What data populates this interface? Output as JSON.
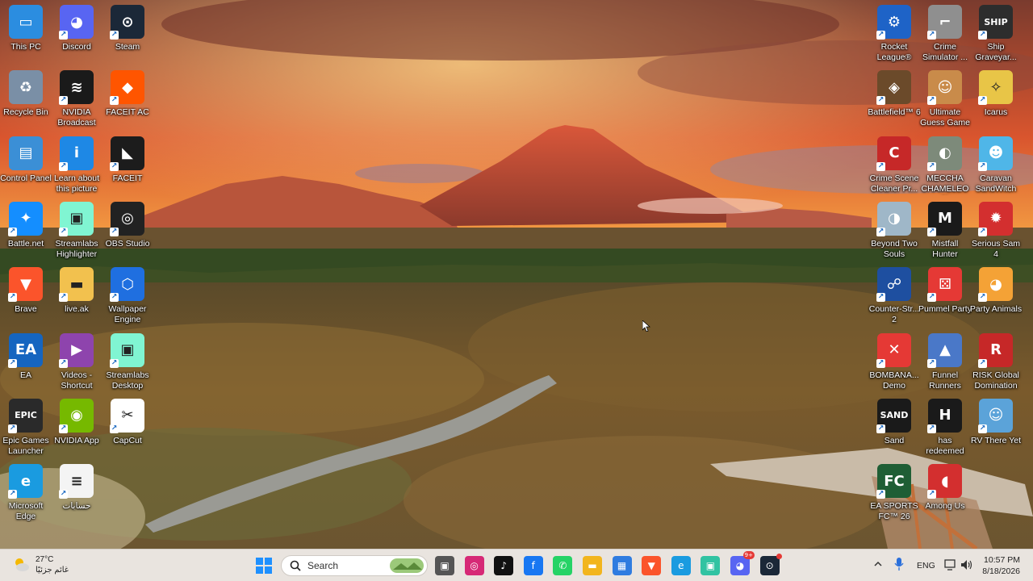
{
  "desktop": {
    "left_icons": [
      {
        "label": "This PC",
        "icon": "monitor-icon",
        "color": "#2b8de0",
        "glyph": "▭"
      },
      {
        "label": "Discord",
        "icon": "discord-icon",
        "color": "#5865f2",
        "glyph": "◕"
      },
      {
        "label": "Steam",
        "icon": "steam-icon",
        "color": "#1b2838",
        "glyph": "⊙"
      },
      {
        "label": "Recycle Bin",
        "icon": "recycle-bin-icon",
        "color": "#7a8fa6",
        "glyph": "♻"
      },
      {
        "label": "NVIDIA Broadcast",
        "icon": "nvidia-broadcast-icon",
        "color": "#1a1a1a",
        "glyph": "≋"
      },
      {
        "label": "FACEIT AC",
        "icon": "faceit-ac-icon",
        "color": "#ff5500",
        "glyph": "◆"
      },
      {
        "label": "Control Panel",
        "icon": "control-panel-icon",
        "color": "#3b8fd6",
        "glyph": "▤"
      },
      {
        "label": "Learn about this picture",
        "icon": "info-icon",
        "color": "#1e88e5",
        "glyph": "i"
      },
      {
        "label": "FACEIT",
        "icon": "faceit-icon",
        "color": "#1c1c1c",
        "glyph": "◣"
      },
      {
        "label": "Battle.net",
        "icon": "battlenet-icon",
        "color": "#148eff",
        "glyph": "✦"
      },
      {
        "label": "Streamlabs Highlighter",
        "icon": "streamlabs-highlighter-icon",
        "color": "#80f5d2",
        "glyph": "▣"
      },
      {
        "label": "OBS Studio",
        "icon": "obs-icon",
        "color": "#222222",
        "glyph": "◎"
      },
      {
        "label": "Brave",
        "icon": "brave-icon",
        "color": "#fb542b",
        "glyph": "▼"
      },
      {
        "label": "live.ak",
        "icon": "folder-icon",
        "color": "#f2c14e",
        "glyph": "▬"
      },
      {
        "label": "Wallpaper Engine",
        "icon": "wallpaper-engine-icon",
        "color": "#1f6fe0",
        "glyph": "⬡"
      },
      {
        "label": "EA",
        "icon": "ea-icon",
        "color": "#1565c0",
        "glyph": "EA"
      },
      {
        "label": "Videos - Shortcut",
        "icon": "videos-icon",
        "color": "#8e44ad",
        "glyph": "▶"
      },
      {
        "label": "Streamlabs Desktop",
        "icon": "streamlabs-desktop-icon",
        "color": "#80f5d2",
        "glyph": "▣"
      },
      {
        "label": "Epic Games Launcher",
        "icon": "epic-games-icon",
        "color": "#2a2a2a",
        "glyph": "EPIC"
      },
      {
        "label": "NVIDIA App",
        "icon": "nvidia-app-icon",
        "color": "#76b900",
        "glyph": "◉"
      },
      {
        "label": "CapCut",
        "icon": "capcut-icon",
        "color": "#ffffff",
        "glyph": "✂"
      },
      {
        "label": "Microsoft Edge",
        "icon": "edge-icon",
        "color": "#1a9be0",
        "glyph": "e"
      },
      {
        "label": "حسابات",
        "icon": "text-file-icon",
        "color": "#f4f4f4",
        "glyph": "≡"
      }
    ],
    "right_icons": [
      {
        "label": "Rocket League®",
        "icon": "rocket-league-icon",
        "color": "#1e63c7",
        "glyph": "⚙"
      },
      {
        "label": "Crime Simulator ...",
        "icon": "crime-simulator-icon",
        "color": "#8f8f8f",
        "glyph": "⌐"
      },
      {
        "label": "Ship Graveyar...",
        "icon": "ship-graveyard-icon",
        "color": "#2d2d2d",
        "glyph": "SHIP"
      },
      {
        "label": "Battlefield™ 6",
        "icon": "battlefield-icon",
        "color": "#6b4a2a",
        "glyph": "◈"
      },
      {
        "label": "Ultimate Guess Game",
        "icon": "guess-game-icon",
        "color": "#c98b4a",
        "glyph": "☺"
      },
      {
        "label": "Icarus",
        "icon": "icarus-icon",
        "color": "#e8c547",
        "glyph": "✧"
      },
      {
        "label": "Crime Scene Cleaner Pr...",
        "icon": "crime-scene-cleaner-icon",
        "color": "#c62828",
        "glyph": "C"
      },
      {
        "label": "MECCHA CHAMELEON",
        "icon": "meccha-chameleon-icon",
        "color": "#7d8a7a",
        "glyph": "◐"
      },
      {
        "label": "Caravan SandWitch",
        "icon": "caravan-sandwitch-icon",
        "color": "#4fb6e8",
        "glyph": "☻"
      },
      {
        "label": "Beyond Two Souls",
        "icon": "beyond-two-souls-icon",
        "color": "#9fb7c8",
        "glyph": "◑"
      },
      {
        "label": "Mistfall Hunter",
        "icon": "mistfall-hunter-icon",
        "color": "#1a1a1a",
        "glyph": "M"
      },
      {
        "label": "Serious Sam 4",
        "icon": "serious-sam-icon",
        "color": "#d32f2f",
        "glyph": "✹"
      },
      {
        "label": "Counter-Str... 2",
        "icon": "counter-strike-icon",
        "color": "#1e4fa0",
        "glyph": "☍"
      },
      {
        "label": "Pummel Party",
        "icon": "pummel-party-icon",
        "color": "#e53935",
        "glyph": "⚄"
      },
      {
        "label": "Party Animals",
        "icon": "party-animals-icon",
        "color": "#f4a236",
        "glyph": "◕"
      },
      {
        "label": "BOMBANA... Demo",
        "icon": "bombana-icon",
        "color": "#e53935",
        "glyph": "✕"
      },
      {
        "label": "Funnel Runners",
        "icon": "funnel-runners-icon",
        "color": "#4a78c8",
        "glyph": "▲"
      },
      {
        "label": "RISK Global Domination",
        "icon": "risk-icon",
        "color": "#c62828",
        "glyph": "R"
      },
      {
        "label": "Sand",
        "icon": "sand-icon",
        "color": "#1a1a1a",
        "glyph": "SAND"
      },
      {
        "label": "has redeemed",
        "icon": "has-redeemed-icon",
        "color": "#1a1a1a",
        "glyph": "H"
      },
      {
        "label": "RV There Yet",
        "icon": "rv-there-yet-icon",
        "color": "#5ba3d9",
        "glyph": "☺"
      },
      {
        "label": "EA SPORTS FC™ 26",
        "icon": "ea-sports-fc-icon",
        "color": "#1f5e35",
        "glyph": "FC"
      },
      {
        "label": "Among Us",
        "icon": "among-us-icon",
        "color": "#d32f2f",
        "glyph": "◖"
      }
    ]
  },
  "taskbar": {
    "weather": {
      "temp": "27°C",
      "desc": "غائم جزئيًا",
      "icon": "partly-cloudy-icon"
    },
    "search_placeholder": "Search",
    "pinned": [
      {
        "name": "task-view-icon",
        "color": "#555555",
        "glyph": "▣"
      },
      {
        "name": "instagram-icon",
        "color": "#d62976",
        "glyph": "◎"
      },
      {
        "name": "tiktok-icon",
        "color": "#111111",
        "glyph": "♪"
      },
      {
        "name": "facebook-icon",
        "color": "#1877f2",
        "glyph": "f"
      },
      {
        "name": "whatsapp-icon",
        "color": "#25d366",
        "glyph": "✆"
      },
      {
        "name": "file-explorer-icon",
        "color": "#f2b51d",
        "glyph": "▬"
      },
      {
        "name": "microsoft-store-icon",
        "color": "#2f7ce0",
        "glyph": "▦"
      },
      {
        "name": "brave-icon",
        "color": "#fb542b",
        "glyph": "▼"
      },
      {
        "name": "edge-icon",
        "color": "#1a9be0",
        "glyph": "e"
      },
      {
        "name": "streamlabs-icon",
        "color": "#31c3a2",
        "glyph": "▣"
      },
      {
        "name": "discord-icon",
        "color": "#5865f2",
        "glyph": "◕"
      },
      {
        "name": "steam-icon",
        "color": "#1b2838",
        "glyph": "⊙"
      }
    ],
    "tray": {
      "language": "ENG"
    },
    "clock": {
      "time": "10:57 PM",
      "date": "8/18/2026"
    },
    "discord_badge": "9+"
  }
}
